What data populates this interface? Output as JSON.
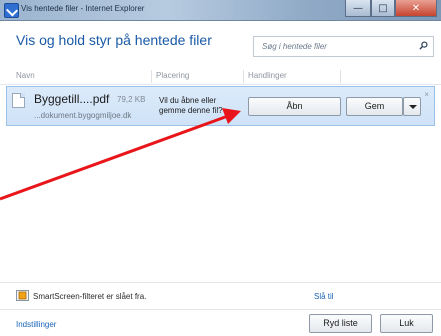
{
  "window": {
    "title": "Vis hentede filer - Internet Explorer",
    "controls": {
      "minimize": "—",
      "maximize": "□",
      "close": "✕"
    }
  },
  "header": {
    "title": "Vis og hold styr på hentede filer",
    "search_placeholder": "Søg i hentede filer"
  },
  "columns": [
    "Navn",
    "Placering",
    "Handlinger"
  ],
  "download": {
    "name": "Byggetill....pdf",
    "size": "79,2 KB",
    "source": "...dokument.bygogmiljoe.dk",
    "prompt": "Vil du åbne eller gemme denne fil?",
    "open_label": "Åbn",
    "save_label": "Gem",
    "close_glyph": "×"
  },
  "smartscreen": {
    "status": "SmartScreen-filteret er slået fra.",
    "enable_link": "Slå til"
  },
  "footer": {
    "settings_link": "Indstillinger",
    "clear_label": "Ryd liste",
    "close_label": "Luk"
  },
  "colors": {
    "accent": "#1a5aa8",
    "row_highlight": "#d5e6f9",
    "arrow": "#e8161b"
  }
}
